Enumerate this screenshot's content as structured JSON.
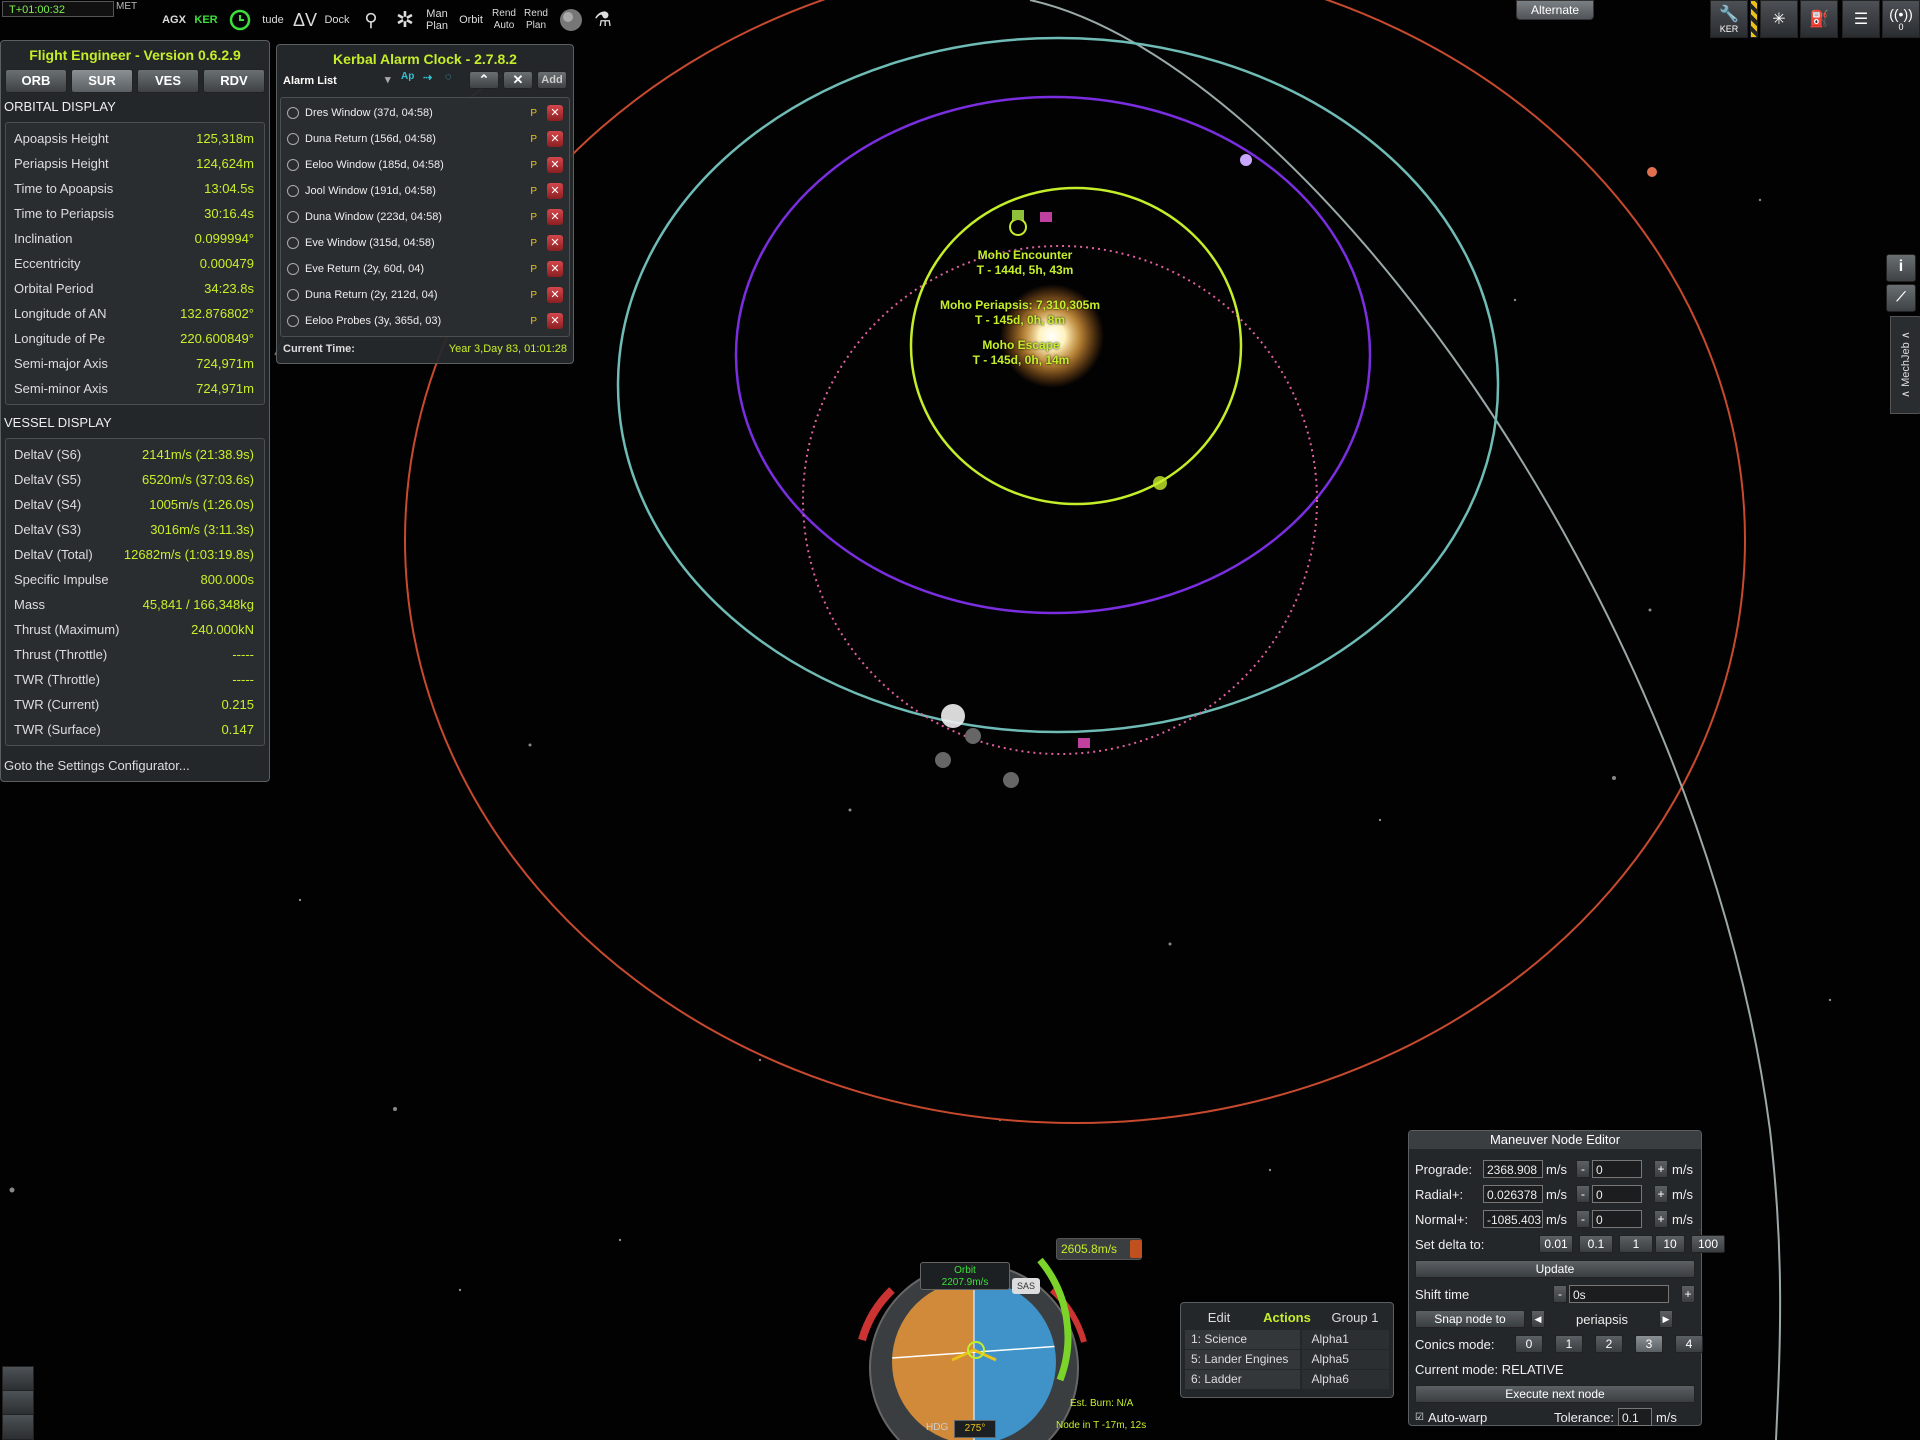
{
  "toolbar": {
    "met_time": "T+01:00:32",
    "met_label": "MET",
    "items": [
      "AGX",
      "KER",
      "clock-icon",
      "tude",
      "ΔV",
      "Dock",
      "lander-icon",
      "gear-icon",
      "Man Plan",
      "Orbit",
      "Rend Auto",
      "Rend Plan",
      "sphere-icon",
      "flask-icon"
    ]
  },
  "flight_engineer": {
    "title": "Flight Engineer  -  Version 0.6.2.9",
    "tabs": [
      "ORB",
      "SUR",
      "VES",
      "RDV"
    ],
    "orbital_header": "ORBITAL DISPLAY",
    "orbital": [
      {
        "label": "Apoapsis Height",
        "value": "125,318m"
      },
      {
        "label": "Periapsis Height",
        "value": "124,624m"
      },
      {
        "label": "Time to Apoapsis",
        "value": "13:04.5s"
      },
      {
        "label": "Time to Periapsis",
        "value": "30:16.4s"
      },
      {
        "label": "Inclination",
        "value": "0.099994°"
      },
      {
        "label": "Eccentricity",
        "value": "0.000479"
      },
      {
        "label": "Orbital Period",
        "value": "34:23.8s"
      },
      {
        "label": "Longitude of AN",
        "value": "132.876802°"
      },
      {
        "label": "Longitude of Pe",
        "value": "220.600849°"
      },
      {
        "label": "Semi-major Axis",
        "value": "724,971m"
      },
      {
        "label": "Semi-minor Axis",
        "value": "724,971m"
      }
    ],
    "vessel_header": "VESSEL DISPLAY",
    "vessel": [
      {
        "label": "DeltaV (S6)",
        "value": "2141m/s (21:38.9s)"
      },
      {
        "label": "DeltaV (S5)",
        "value": "6520m/s (37:03.6s)"
      },
      {
        "label": "DeltaV (S4)",
        "value": "1005m/s (1:26.0s)"
      },
      {
        "label": "DeltaV (S3)",
        "value": "3016m/s (3:11.3s)"
      },
      {
        "label": "DeltaV (Total)",
        "value": "12682m/s (1:03:19.8s)"
      },
      {
        "label": "Specific Impulse",
        "value": "800.000s"
      },
      {
        "label": "Mass",
        "value": "45,841 / 166,348kg"
      },
      {
        "label": "Thrust (Maximum)",
        "value": "240.000kN"
      },
      {
        "label": "Thrust (Throttle)",
        "value": "-----"
      },
      {
        "label": "TWR (Throttle)",
        "value": "-----"
      },
      {
        "label": "TWR (Current)",
        "value": "0.215"
      },
      {
        "label": "TWR (Surface)",
        "value": "0.147"
      }
    ],
    "settings_link": "Goto the Settings Configurator..."
  },
  "alarm_clock": {
    "title": "Kerbal Alarm Clock - 2.7.8.2",
    "list_label": "Alarm List",
    "ap_label": "Ap",
    "add_label": "Add",
    "alarms": [
      {
        "label": "Dres Window (37d, 04:58)",
        "flag": "P"
      },
      {
        "label": "Duna Return (156d, 04:58)",
        "flag": "P"
      },
      {
        "label": "Eeloo Window (185d, 04:58)",
        "flag": "P"
      },
      {
        "label": "Jool Window (191d, 04:58)",
        "flag": "P"
      },
      {
        "label": "Duna Window (223d, 04:58)",
        "flag": "P"
      },
      {
        "label": "Eve Window (315d, 04:58)",
        "flag": "P"
      },
      {
        "label": "Eve Return (2y, 60d, 04)",
        "flag": "P"
      },
      {
        "label": "Duna Return  (2y, 212d, 04)",
        "flag": "P"
      },
      {
        "label": "Eeloo Probes (3y, 365d, 03)",
        "flag": "P"
      }
    ],
    "current_time_label": "Current Time:",
    "current_time_value": "Year 3,Day 83, 01:01:28"
  },
  "map_labels": {
    "encounter": [
      "Moho Encounter",
      "T - 144d, 5h, 43m"
    ],
    "periapsis": [
      "Moho Periapsis: 7,310,305m",
      "T - 145d, 0h, 8m"
    ],
    "escape": [
      "Moho Escape",
      "T - 145d, 0h, 14m"
    ],
    "colors": {
      "moho": "#c5ee2a",
      "eve": "#7a2ee0",
      "kerbin": "#6fbcb6",
      "duna": "#c84a2e",
      "pink": "#e060a0"
    }
  },
  "right_top": {
    "alternate_label": "Alternate",
    "icons": [
      "KER",
      "hazard-icon",
      "science-icon",
      "fuel-icon",
      "checklist-icon",
      "antenna-icon"
    ],
    "antenna_count": "0"
  },
  "side": {
    "mechjeb": "∧ MechJeb ∧",
    "info": "i"
  },
  "navball": {
    "mode": "Orbit",
    "speed": "2207.9m/s",
    "sas": "SAS",
    "hdg_label": "HDG",
    "hdg_value": "275°",
    "burn_dv": "2605.8m/s",
    "est_burn": "Est. Burn: N/A",
    "node_in": "Node in T -17m, 12s"
  },
  "action_groups": {
    "tabs": [
      "Edit",
      "Actions",
      "Group 1"
    ],
    "rows": [
      {
        "action": "1: Science",
        "group": "Alpha1"
      },
      {
        "action": "5: Lander Engines",
        "group": "Alpha5"
      },
      {
        "action": "6: Ladder",
        "group": "Alpha6"
      }
    ]
  },
  "maneuver": {
    "title": "Maneuver Node Editor",
    "prograde_label": "Prograde:",
    "prograde_value": "2368.908",
    "prograde_delta": "0",
    "radial_label": "Radial+:",
    "radial_value": "0.026378",
    "radial_delta": "0",
    "normal_label": "Normal+:",
    "normal_value": "-1085.403",
    "normal_delta": "0",
    "unit": "m/s",
    "set_delta_label": "Set delta to:",
    "delta_options": [
      "0.01",
      "0.1",
      "1",
      "10",
      "100"
    ],
    "update": "Update",
    "shift_label": "Shift time",
    "shift_value": "0s",
    "snap_label": "Snap node to",
    "snap_target": "periapsis",
    "conics_label": "Conics mode:",
    "conics_options": [
      "0",
      "1",
      "2",
      "3",
      "4"
    ],
    "current_mode": "Current mode: RELATIVE",
    "execute": "Execute next node",
    "autowarp": "Auto-warp",
    "tolerance_label": "Tolerance:",
    "tolerance_value": "0.1",
    "tolerance_unit": "m/s"
  }
}
